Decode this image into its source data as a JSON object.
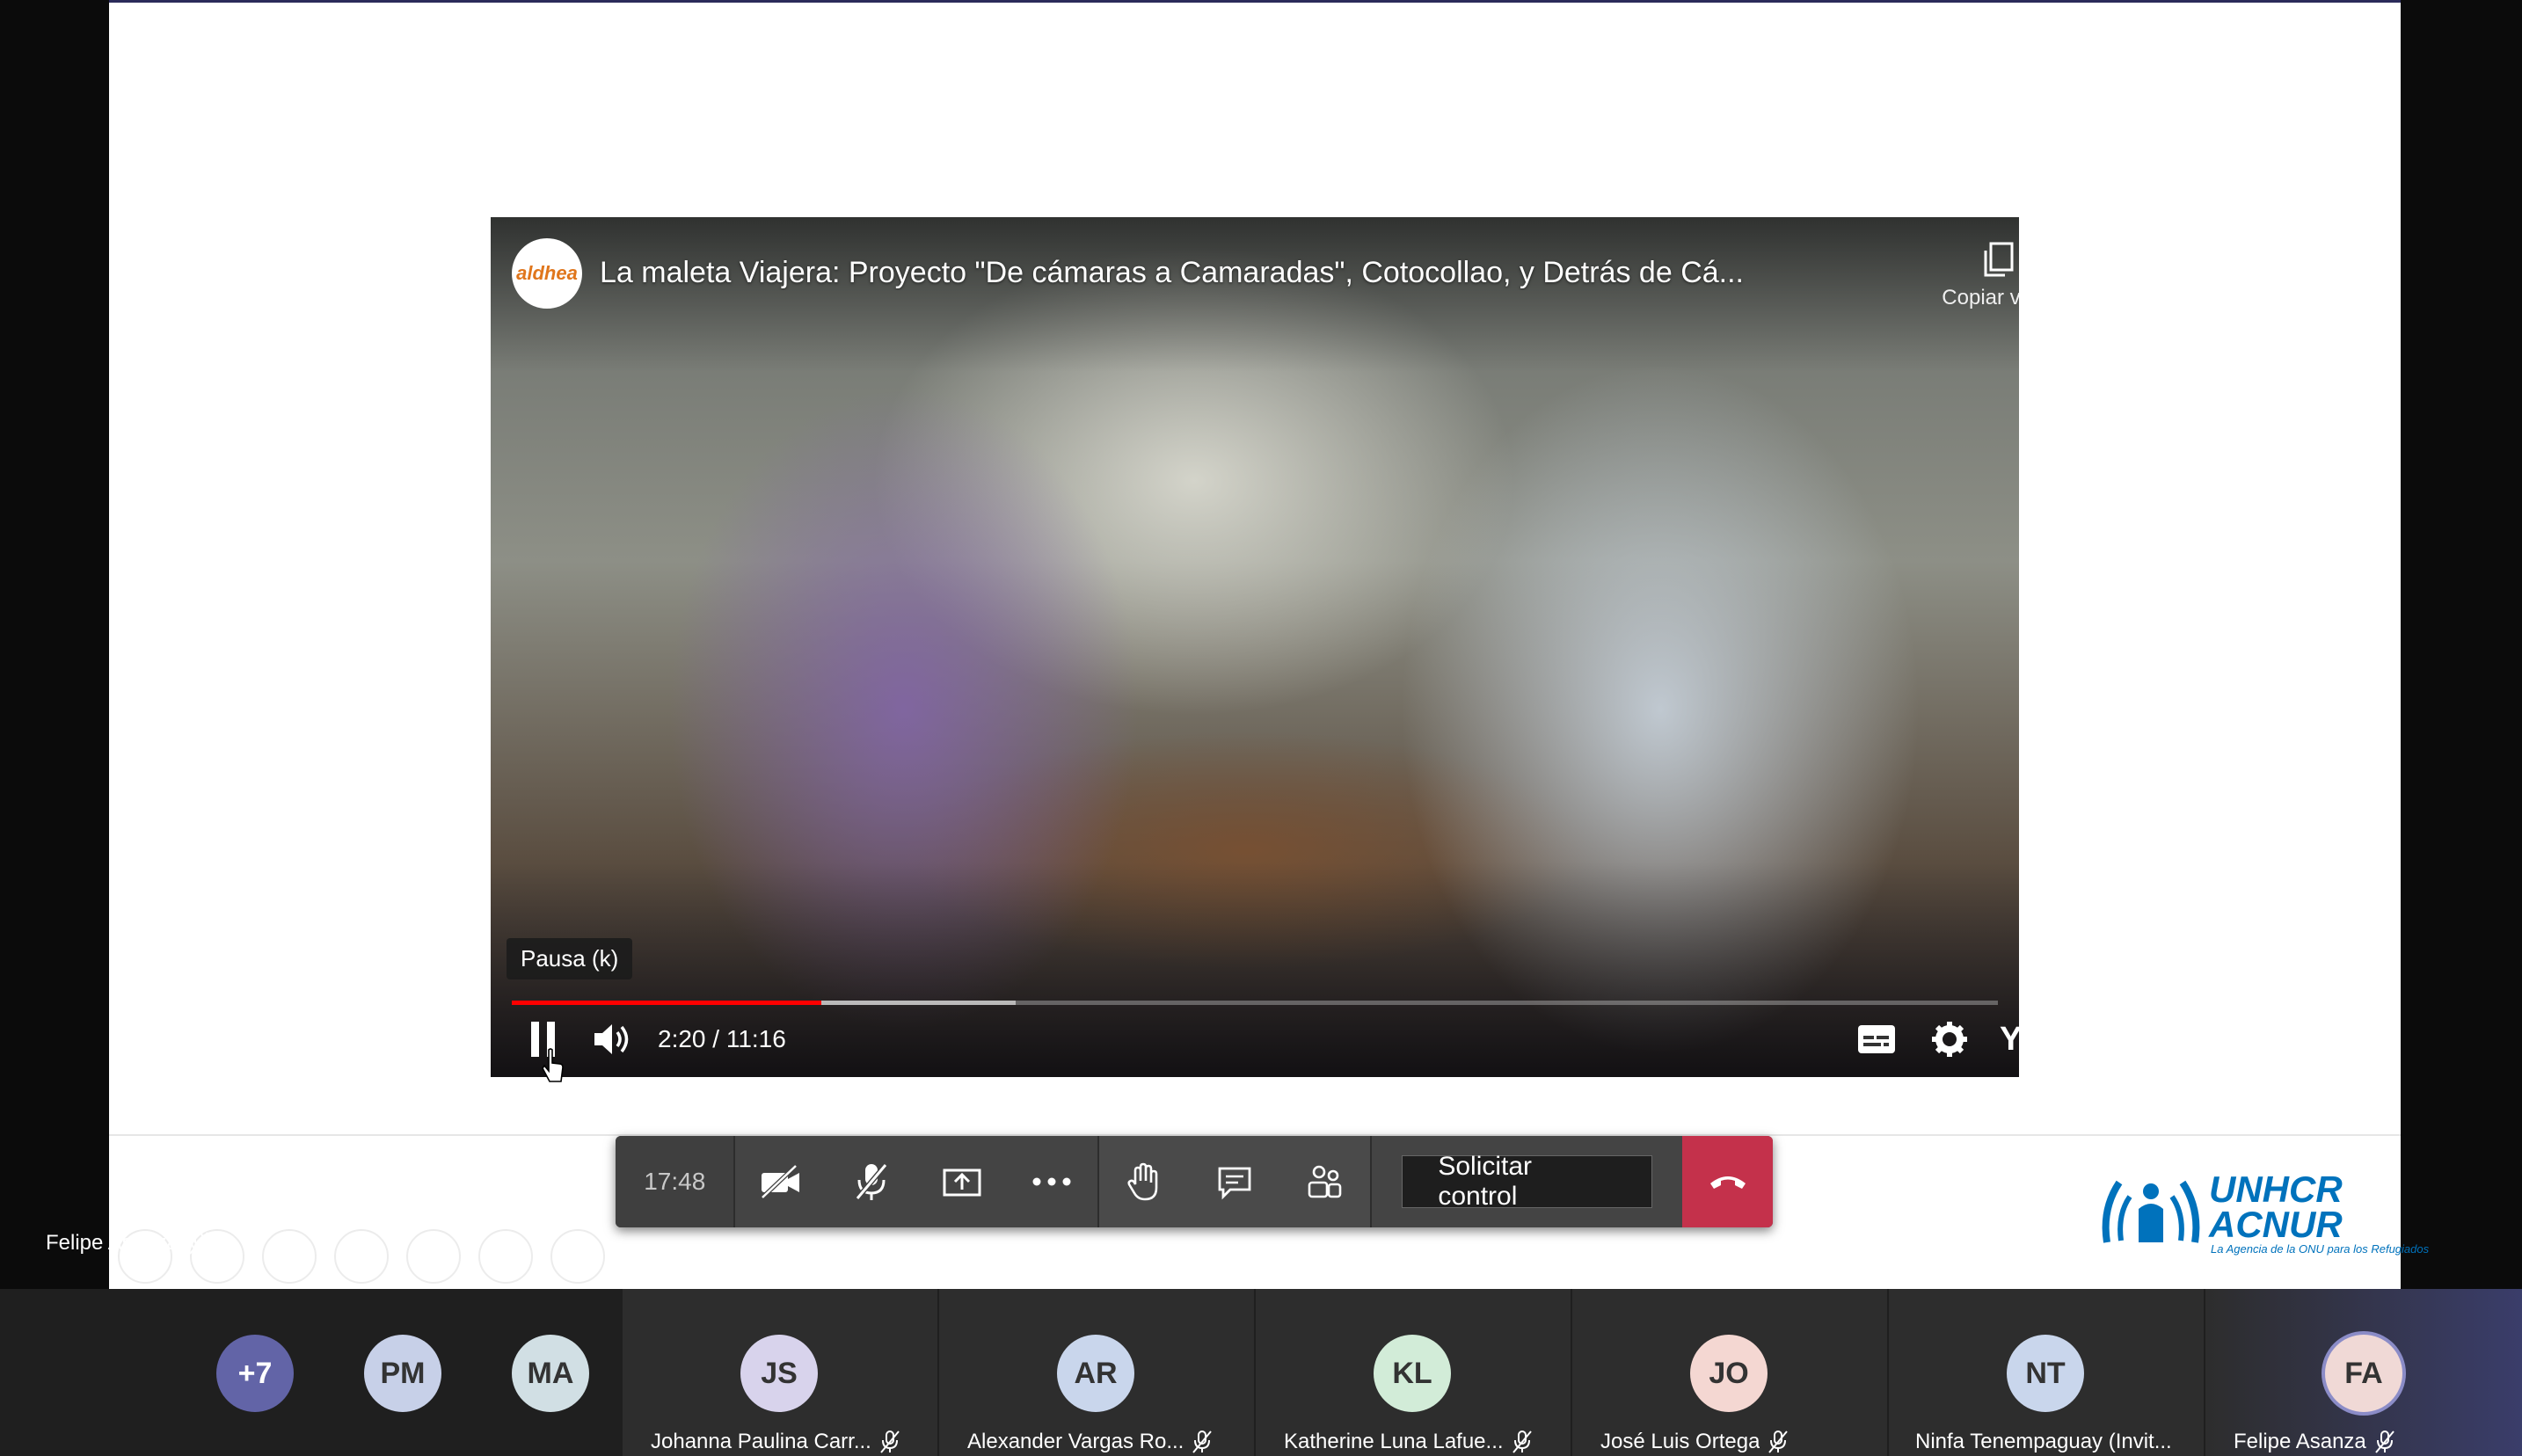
{
  "video": {
    "channel_logo_text": "aldhea",
    "title": "La maleta Viajera: Proyecto \"De cámaras a Camaradas\", Cotocollao, y Detrás de Cá...",
    "copy_link_label": "Copiar vín...",
    "tooltip": "Pausa (k)",
    "time": "2:20 / 11:16",
    "played_fraction": 0.208,
    "buffered_fraction": 0.339,
    "brand": "YouTube",
    "accent_color": "#ff0000"
  },
  "slide_brand": {
    "name_line1": "UNHCR",
    "name_line2": "ACNUR",
    "tagline": "La Agencia de la ONU para los Refugiados",
    "color": "#0072bc"
  },
  "presenter": {
    "name": "Felipe Asanza"
  },
  "meeting_bar": {
    "timer": "17:48",
    "buttons": [
      "camera-off-icon",
      "mic-off-icon",
      "share-screen-icon",
      "more-options-icon",
      "raise-hand-icon",
      "chat-icon",
      "participants-icon"
    ],
    "request_control_label": "Solicitar control",
    "hangup_color": "#c4314b"
  },
  "participants": {
    "overflow": {
      "label": "+7",
      "color": "#6264a7"
    },
    "small": [
      {
        "initials": "PM",
        "color": "#c7d0e8"
      },
      {
        "initials": "MA",
        "color": "#d1dfe4"
      }
    ],
    "tiles": [
      {
        "initials": "JS",
        "name": "Johanna Paulina Carr...",
        "color": "#d8d3ec"
      },
      {
        "initials": "AR",
        "name": "Alexander Vargas Ro...",
        "color": "#c9d6ec"
      },
      {
        "initials": "KL",
        "name": "Katherine Luna Lafue...",
        "color": "#d2ecd8"
      },
      {
        "initials": "JO",
        "name": "José Luis Ortega",
        "color": "#f4d7d2"
      },
      {
        "initials": "NT",
        "name": "Ninfa Tenempaguay (Invit...",
        "color": "#c9d6ec"
      },
      {
        "initials": "FA",
        "name": "Felipe Asanza",
        "color": "#f0d9d6"
      }
    ]
  }
}
